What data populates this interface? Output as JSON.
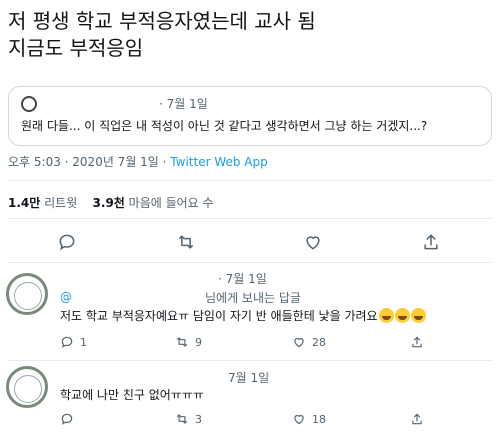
{
  "tweet": {
    "line1": "저 평생 학교 부적응자였는데 교사 됨",
    "line2": "지금도 부적응임"
  },
  "quote": {
    "date": "· 7월 1일",
    "text": "원래 다들... 이 직업은 내 적성이 아닌 것 같다고 생각하면서 그냥 하는 거겠지...?"
  },
  "meta": {
    "time": "오후 5:03 · 2020년 7월 1일 · ",
    "app": "Twitter Web App"
  },
  "stats": {
    "retweets_count": "1.4만",
    "retweets_label": "리트윗",
    "likes_count": "3.9천",
    "likes_label": "마음에 들어요 수"
  },
  "replies": [
    {
      "handle": "@",
      "date": "· 7월 1일",
      "replying_to": "님에게 보내는 답글",
      "text": "저도 학교 부적응자예요ㅠ 담임이 자기 반 애들한테 낯을 가려요",
      "emoji": [
        "rofl-emoji",
        "rofl-emoji",
        "rofl-emoji"
      ],
      "reply_count": "1",
      "retweet_count": "9",
      "like_count": "28"
    },
    {
      "date": "7월 1일",
      "text": "학교에 나만 친구 없어ㅠㅠㅠ",
      "reply_count": "",
      "retweet_count": "3",
      "like_count": "18"
    }
  ],
  "colors": {
    "link": "#1d9bf0",
    "muted": "#536471",
    "border": "#cfd9de"
  }
}
